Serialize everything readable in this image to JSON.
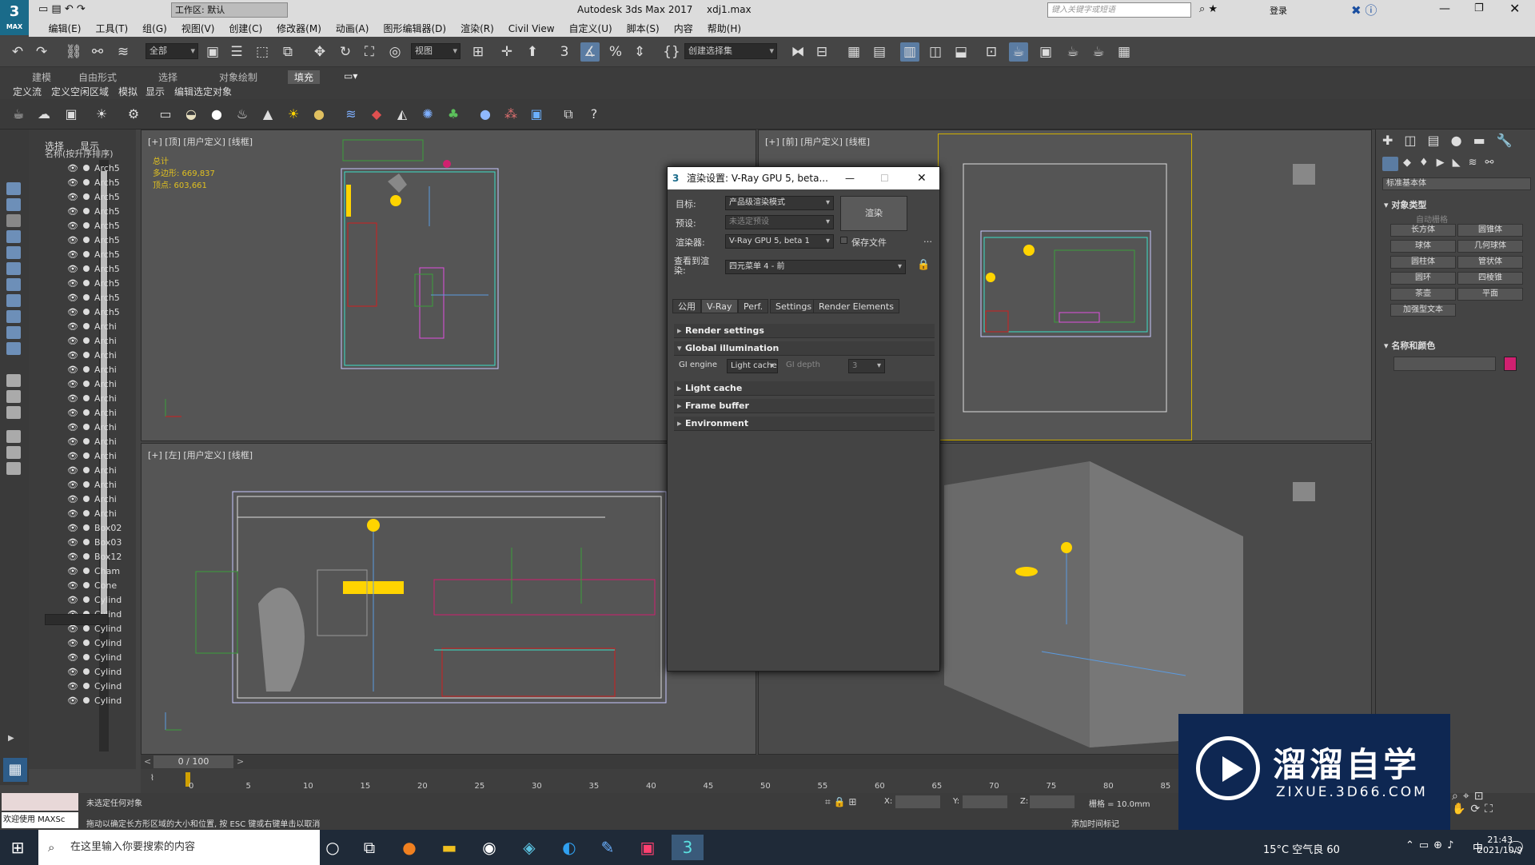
{
  "app": {
    "title": "Autodesk 3ds Max 2017",
    "file": "xdj1.max",
    "workspace": "工作区: 默认",
    "search_placeholder": "键入关键字或短语",
    "login": "登录",
    "logo": "3",
    "logo_sub": "MAX"
  },
  "menu": [
    "编辑(E)",
    "工具(T)",
    "组(G)",
    "视图(V)",
    "创建(C)",
    "修改器(M)",
    "动画(A)",
    "图形编辑器(D)",
    "渲染(R)",
    "Civil View",
    "自定义(U)",
    "脚本(S)",
    "内容",
    "帮助(H)"
  ],
  "toolbar": {
    "filter": "全部",
    "view": "视图",
    "selset": "创建选择集"
  },
  "ribbon": {
    "tabs": [
      "建模",
      "自由形式",
      "选择",
      "对象绘制",
      "填充"
    ],
    "sub": [
      "定义流",
      "定义空闲区域",
      "模拟",
      "显示",
      "编辑选定对象"
    ]
  },
  "scene": {
    "tabs": [
      "选择",
      "显示"
    ],
    "header": "名称(按升序排序)",
    "rows": [
      "Arch5",
      "Arch5",
      "Arch5",
      "Arch5",
      "Arch5",
      "Arch5",
      "Arch5",
      "Arch5",
      "Arch5",
      "Arch5",
      "Arch5",
      "Archi",
      "Archi",
      "Archi",
      "Archi",
      "Archi",
      "Archi",
      "Archi",
      "Archi",
      "Archi",
      "Archi",
      "Archi",
      "Archi",
      "Archi",
      "Archi",
      "Box02",
      "Box03",
      "Box12",
      "Cham",
      "Cone",
      "Cylind",
      "Cylind",
      "Cylind",
      "Cylind",
      "Cylind",
      "Cylind",
      "Cylind",
      "Cylind"
    ]
  },
  "viewports": {
    "top": "[+] [顶] [用户定义] [线框]",
    "front": "[+] [前] [用户定义] [线框]",
    "left": "[+] [左] [用户定义] [线框]",
    "stats": {
      "label": "总计",
      "poly": "多边形: 669,837",
      "verts": "顶点: 603,661"
    }
  },
  "dialog": {
    "title": "渲染设置: V-Ray GPU 5, beta...",
    "target_label": "目标:",
    "target": "产品级渲染模式",
    "preset_label": "预设:",
    "preset": "未选定预设",
    "renderer_label": "渲染器:",
    "renderer": "V-Ray GPU 5, beta 1",
    "save_file": "保存文件",
    "render_btn": "渲染",
    "view_label": "查看到渲染:",
    "view": "四元菜单 4 - 前",
    "tabs": [
      "公用",
      "V-Ray",
      "Perf.",
      "Settings",
      "Render Elements"
    ],
    "rollouts": {
      "render_settings": "Render settings",
      "gi": "Global illumination",
      "gi_engine_label": "GI engine",
      "gi_engine": "Light cache",
      "gi_depth_label": "GI depth",
      "gi_depth": "3",
      "light_cache": "Light cache",
      "frame_buffer": "Frame buffer",
      "environment": "Environment"
    }
  },
  "cmd": {
    "category": "标准基本体",
    "object_type": "对象类型",
    "autogrid": "自动栅格",
    "buttons": [
      "长方体",
      "圆锥体",
      "球体",
      "几何球体",
      "圆柱体",
      "管状体",
      "圆环",
      "四棱锥",
      "茶壶",
      "平面",
      "加强型文本"
    ],
    "name_color": "名称和颜色",
    "swatch": "#d02070"
  },
  "timeline": {
    "frame": "0 / 100",
    "ticks": [
      "0",
      "5",
      "10",
      "15",
      "20",
      "25",
      "30",
      "35",
      "40",
      "45",
      "50",
      "55",
      "60",
      "65",
      "70",
      "75",
      "80",
      "85"
    ]
  },
  "status": {
    "welcome": "欢迎使用 MAXSc",
    "none_selected": "未选定任何对象",
    "hint": "拖动以确定长方形区域的大小和位置, 按 ESC 键或右键单击以取消",
    "x": "X:",
    "y": "Y:",
    "z": "Z:",
    "grid": "栅格 = 10.0mm",
    "add_tag": "添加时间标记"
  },
  "taskbar": {
    "search": "在这里输入你要搜索的内容",
    "weather": "15°C 空气良 60",
    "time": "21:43",
    "date": "2021/10/9",
    "ime": "中"
  },
  "watermark": {
    "title": "溜溜自学",
    "url": "ZIXUE.3D66.COM"
  }
}
